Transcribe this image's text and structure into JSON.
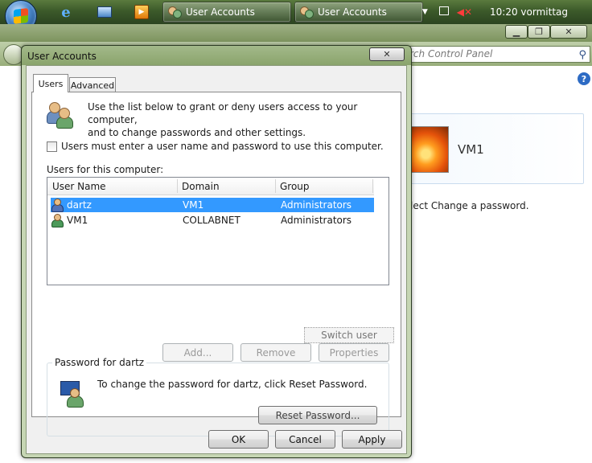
{
  "taskbar": {
    "buttons": [
      {
        "label": "User Accounts"
      },
      {
        "label": "User Accounts"
      }
    ],
    "clock": "10:20 vormittag"
  },
  "control_panel": {
    "search_placeholder": "rch Control Panel",
    "user_name": "VM1",
    "hint_text": "lect Change a password."
  },
  "dialog": {
    "title": "User Accounts",
    "tabs": [
      {
        "label": "Users",
        "selected": true
      },
      {
        "label": "Advanced",
        "selected": false
      }
    ],
    "intro_line1": "Use the list below to grant or deny users access to your computer,",
    "intro_line2": "and to change passwords and other settings.",
    "require_login_checkbox": {
      "label": "Users must enter a user name and password to use this computer.",
      "checked": false
    },
    "users_label": "Users for this computer:",
    "columns": [
      "User Name",
      "Domain",
      "Group"
    ],
    "rows": [
      {
        "user": "dartz",
        "domain": "VM1",
        "group": "Administrators",
        "selected": true
      },
      {
        "user": "VM1",
        "domain": "COLLABNET",
        "group": "Administrators",
        "selected": false
      }
    ],
    "switch_user_label": "Switch user",
    "add_label": "Add...",
    "remove_label": "Remove",
    "properties_label": "Properties",
    "password_group": {
      "legend": "Password for dartz",
      "text": "To change the password for dartz, click Reset Password.",
      "reset_label": "Reset Password..."
    },
    "ok_label": "OK",
    "cancel_label": "Cancel",
    "apply_label": "Apply"
  },
  "colors": {
    "selection": "#3399ff",
    "taskbar": "#3c5a2a",
    "window_frame": "#c6d6b4"
  }
}
